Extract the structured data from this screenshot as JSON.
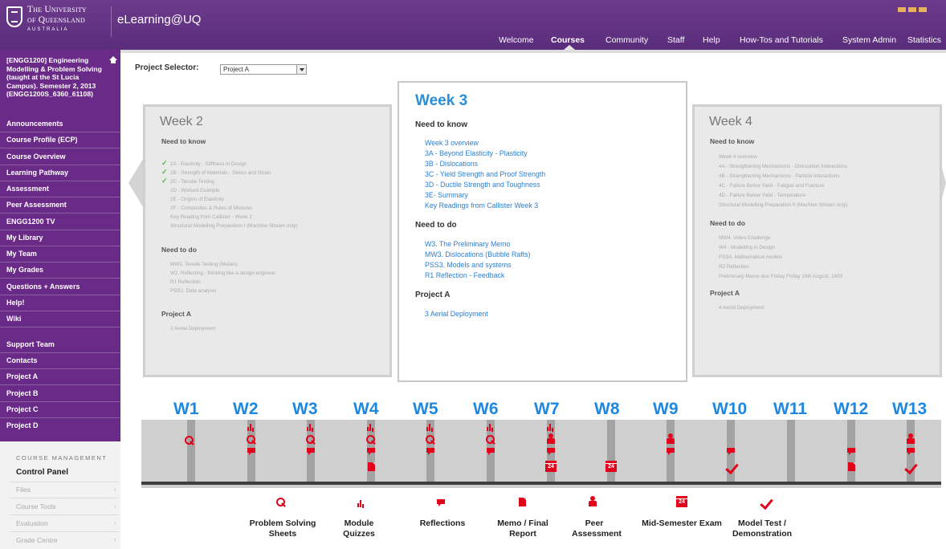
{
  "header": {
    "logo_line1": "The University",
    "logo_line2": "of Queensland",
    "logo_line3": "AUSTRALIA",
    "site_title": "eLearning@UQ",
    "nav": [
      "Welcome",
      "Courses",
      "Community",
      "Staff",
      "Help",
      "How-Tos and Tutorials",
      "System Admin",
      "Statistics"
    ],
    "active_nav": "Courses"
  },
  "sidebar": {
    "course_title": "[ENGG1200] Engineering Modelling & Problem Solving (taught at the St Lucia Campus). Semester 2, 2013 (ENGG1200S_6360_61108)",
    "links": [
      "Announcements",
      "Course Profile (ECP)",
      "Course Overview",
      "Learning Pathway",
      "Assessment",
      "Peer Assessment",
      "ENGG1200 TV",
      "My Library",
      "My Team",
      "My Grades",
      "Questions + Answers",
      "Help!",
      "Wiki"
    ],
    "links2": [
      "Support Team",
      "Contacts",
      "Project A",
      "Project B",
      "Project C",
      "Project D"
    ],
    "management": {
      "title": "COURSE MANAGEMENT",
      "control_panel": "Control Panel",
      "items": [
        "Files",
        "Course Tools",
        "Evaluation",
        "Grade Centre"
      ]
    }
  },
  "selector": {
    "label": "Project Selector:",
    "value": "Project A"
  },
  "cards": {
    "week2": {
      "title": "Week 2",
      "need_to_know": "Need to know",
      "know_items": [
        "2A - Elasticity - Stiffness in Design",
        "2B - Strength of Materials - Stress and Strain",
        "2C - Tensile Testing",
        "2D - Worked Example",
        "2E - Origins of Elasticity",
        "2F - Composites & Rules of Mixtures",
        "Key Reading from Callister - Week 2",
        "Structural Modelling Preparation I (Machine Stream only)"
      ],
      "need_to_do": "Need to do",
      "do_items": [
        "MW2. Tensile Testing (Metals)",
        "W2. Reflecting - thinking like a design engineer",
        "R1 Reflection",
        "PSS2. Data analysis"
      ],
      "project_head": "Project A",
      "project_items": [
        "2 Aerial Deployment"
      ]
    },
    "week3": {
      "title": "Week 3",
      "need_to_know": "Need to know",
      "know_items": [
        "Week 3 overview",
        "3A - Beyond Elasticity - Plasticity",
        "3B - Dislocations",
        "3C - Yield Strength and Proof Strength",
        "3D - Ductile Strength and Toughness",
        "3E- Summary",
        "Key Readings from Callister Week 3"
      ],
      "need_to_do": "Need to do",
      "do_items": [
        "W3. The Preliminary Memo",
        "MW3. Dislocations (Bubble Rafts)",
        "PSS3. Models and systems",
        "R1 Reflection - Feedback"
      ],
      "project_head": "Project A",
      "project_items": [
        "3 Aerial Deployment"
      ]
    },
    "week4": {
      "title": "Week 4",
      "need_to_know": "Need to know",
      "know_items": [
        "Week 4 overview",
        "4A - Strengthening Mechanisms - Dislocation Interactions",
        "4B - Strengthening Mechanisms - Particle Interactions",
        "4C - Failure Below Yield - Fatigue and Fracture",
        "4D - Failure Below Yield - Temperature",
        "Structural Modelling Preparation II (Machine Stream only)"
      ],
      "need_to_do": "Need to do",
      "do_items": [
        "MW4. Video Challenge",
        "W4 - Modelling in Design",
        "PSS4. Mathematical models",
        "R2 Reflection",
        "Preliminary Memo due Friday Friday 16th August, 1600"
      ],
      "project_head": "Project A",
      "project_items": [
        "4 Aerial Deployment"
      ]
    }
  },
  "timeline": {
    "weeks": [
      "W1",
      "W2",
      "W3",
      "W4",
      "W5",
      "W6",
      "W7",
      "W8",
      "W9",
      "W10",
      "W11",
      "W12",
      "W13"
    ],
    "calendar_day": "24",
    "legend": [
      "Problem Solving Sheets",
      "Module Quizzes",
      "Reflections",
      "Memo / Final Report",
      "Peer Assessment",
      "Mid-Semester Exam",
      "Model Test / Demonstration"
    ],
    "icon_names": [
      "magnifier-icon",
      "bar-chart-icon",
      "speech-bubble-icon",
      "document-icon",
      "person-icon",
      "calendar-icon",
      "checkmark-icon"
    ],
    "accent_color": "#e3001b",
    "week_color": "#1e88e0"
  }
}
